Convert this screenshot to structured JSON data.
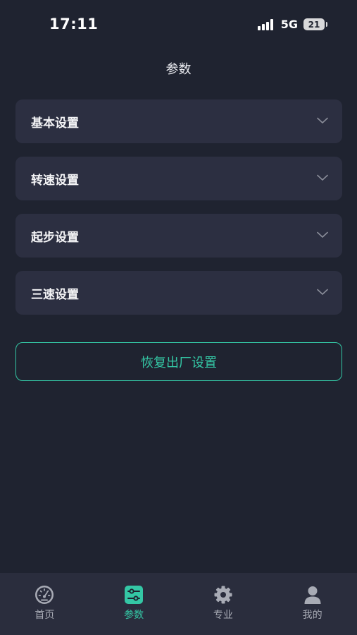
{
  "status_bar": {
    "time": "17:11",
    "network": "5G",
    "battery": "21"
  },
  "header": {
    "title": "参数"
  },
  "settings": [
    {
      "label": "基本设置"
    },
    {
      "label": "转速设置"
    },
    {
      "label": "起步设置"
    },
    {
      "label": "三速设置"
    }
  ],
  "reset_button": {
    "label": "恢复出厂设置"
  },
  "tab_bar": {
    "tabs": [
      {
        "label": "首页",
        "icon": "speedometer-icon",
        "active": false
      },
      {
        "label": "参数",
        "icon": "sliders-icon",
        "active": true
      },
      {
        "label": "专业",
        "icon": "gear-icon",
        "active": false
      },
      {
        "label": "我的",
        "icon": "user-icon",
        "active": false
      }
    ]
  },
  "colors": {
    "background": "#1f2330",
    "card": "#2c2f41",
    "accent": "#34c7a5",
    "tab_bar": "#2a2d3d",
    "inactive_text": "#a8abb5"
  }
}
